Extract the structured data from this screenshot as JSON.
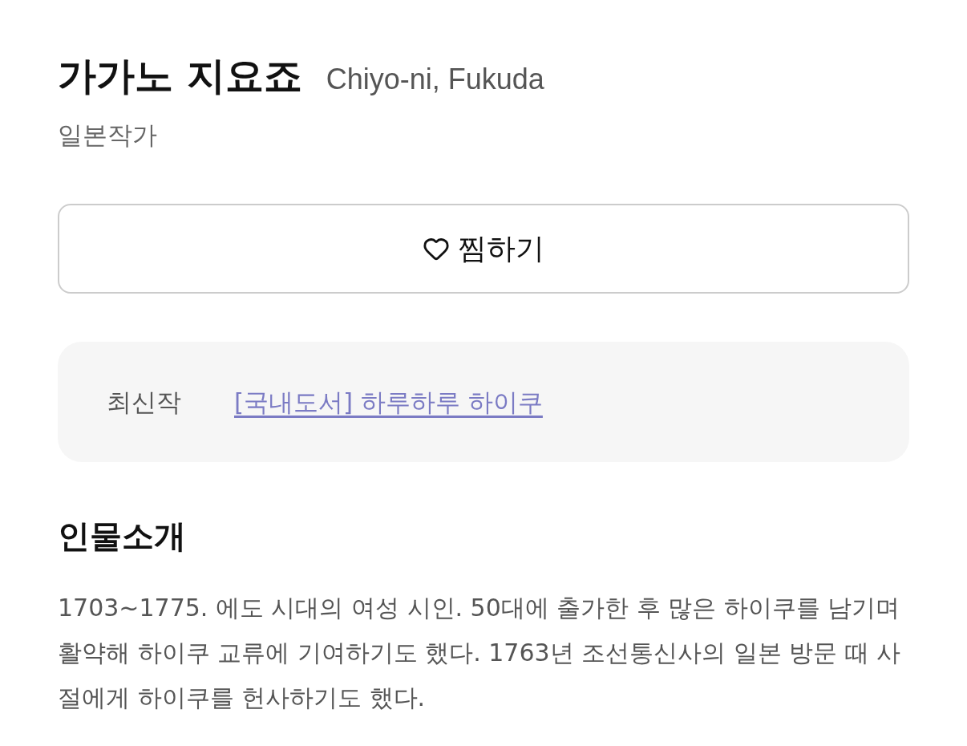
{
  "author": {
    "name": "가가노 지요죠",
    "name_original": "Chiyo-ni, Fukuda",
    "category": "일본작가"
  },
  "wishlist_button": {
    "label": "찜하기",
    "wished": false
  },
  "latest_work": {
    "label": "최신작",
    "title": "[국내도서] 하루하루 하이쿠"
  },
  "biography": {
    "heading": "인물소개",
    "text": "1703~1775. 에도 시대의 여성 시인. 50대에 출가한 후 많은 하이쿠를 남기며 활약해 하이쿠 교류에 기여하기도 했다. 1763년 조선통신사의 일본 방문 때 사절에게 하이쿠를 헌사하기도 했다."
  }
}
